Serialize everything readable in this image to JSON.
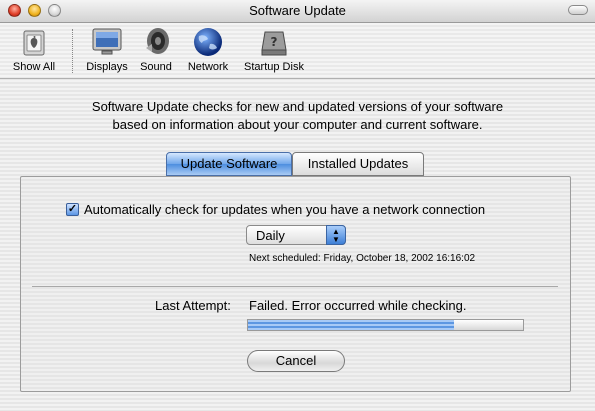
{
  "window": {
    "title": "Software Update"
  },
  "toolbar": {
    "items": [
      {
        "label": "Show All",
        "icon": "apple-switch-icon"
      },
      {
        "label": "Displays",
        "icon": "monitor-icon"
      },
      {
        "label": "Sound",
        "icon": "speaker-icon"
      },
      {
        "label": "Network",
        "icon": "globe-icon"
      },
      {
        "label": "Startup Disk",
        "icon": "hard-disk-icon"
      }
    ]
  },
  "description": {
    "line1": "Software Update checks for new and updated versions of your software",
    "line2": "based on information about your computer and current software."
  },
  "tabs": [
    {
      "label": "Update Software",
      "active": true
    },
    {
      "label": "Installed Updates",
      "active": false
    }
  ],
  "auto_check": {
    "checked": true,
    "label": "Automatically check for updates when you have a network connection"
  },
  "frequency": {
    "selected": "Daily"
  },
  "next_scheduled": "Next scheduled: Friday, October 18, 2002 16:16:02",
  "last_attempt": {
    "label": "Last Attempt:",
    "value": "Failed. Error occurred while checking."
  },
  "progress": {
    "fraction": 0.75
  },
  "buttons": {
    "cancel": "Cancel"
  },
  "colors": {
    "accent": "#4d8ee0",
    "fill": "#5d97e2"
  }
}
